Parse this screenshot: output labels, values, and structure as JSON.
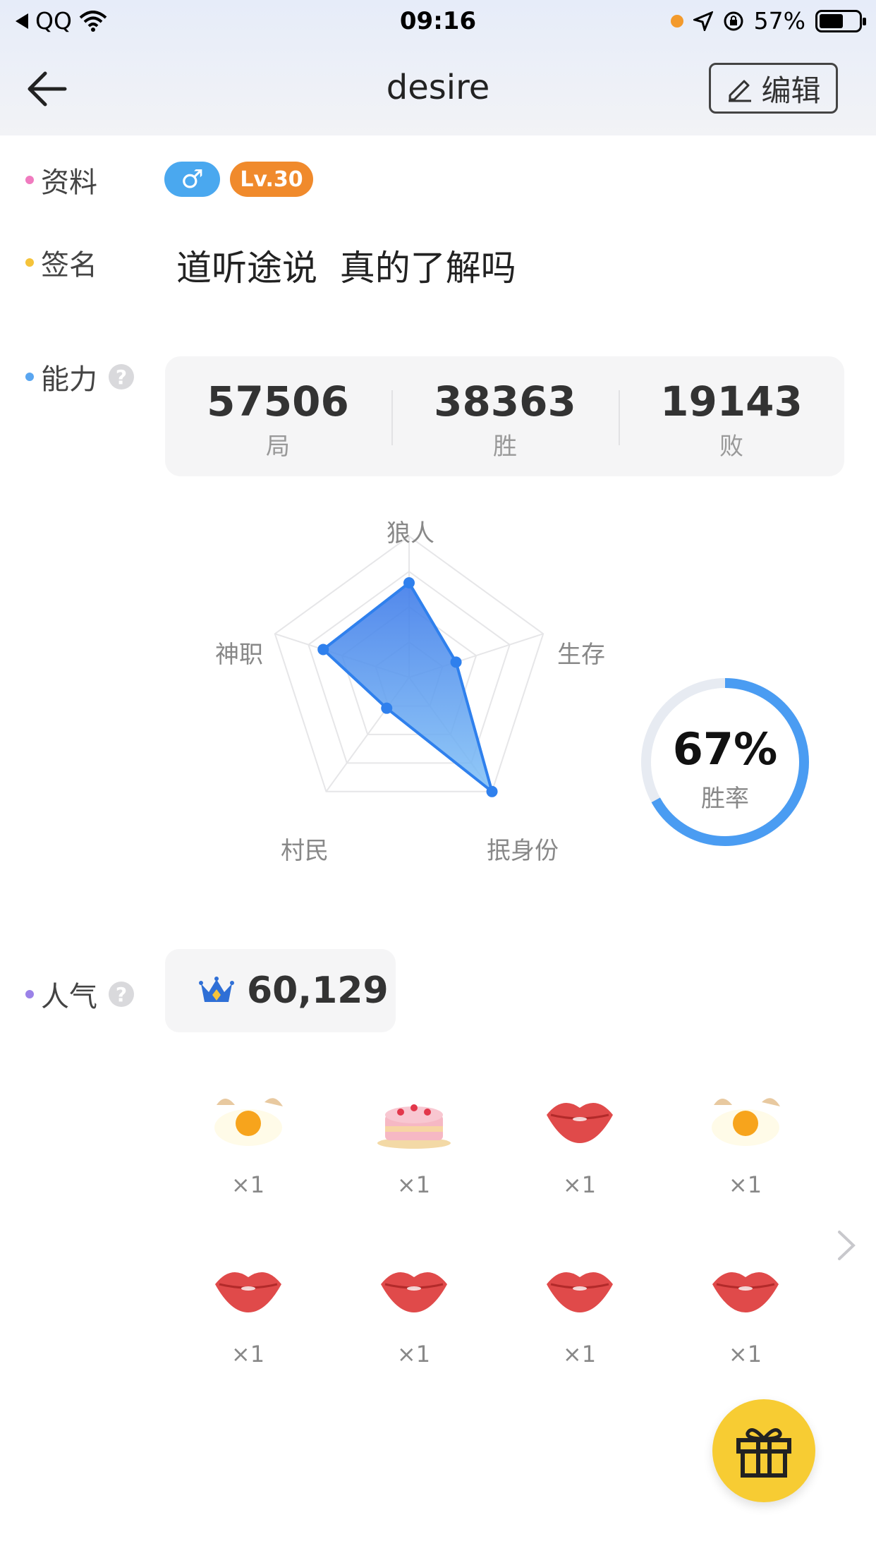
{
  "status_bar": {
    "carrier": "QQ",
    "time": "09:16",
    "battery": "57%",
    "icons": [
      "back-triangle-icon",
      "wifi-icon",
      "orange-dot-icon",
      "location-arrow-icon",
      "rotation-lock-icon",
      "battery-icon"
    ]
  },
  "nav": {
    "title": "desire",
    "edit_label": "编辑",
    "back_icon": "arrow-left-icon",
    "edit_icon": "pencil-icon"
  },
  "profile": {
    "label": "资料",
    "gender_symbol": "♂",
    "level": "Lv.30"
  },
  "signature": {
    "label": "签名",
    "text": "道听途说  真的了解吗"
  },
  "ability": {
    "label": "能力",
    "help": "?",
    "stats": [
      {
        "value": "57506",
        "label": "局"
      },
      {
        "value": "38363",
        "label": "胜"
      },
      {
        "value": "19143",
        "label": "败"
      }
    ],
    "radar": {
      "axes": [
        "狼人",
        "生存",
        "抿身份",
        "村民",
        "神职"
      ],
      "values": [
        0.67,
        0.35,
        1.0,
        0.27,
        0.64
      ]
    },
    "win_rate": {
      "value": "67%",
      "label": "胜率",
      "fraction": 0.67
    }
  },
  "popularity": {
    "label": "人气",
    "help": "?",
    "value": "60,129",
    "icon": "crown-icon"
  },
  "gifts": [
    {
      "icon": "egg-icon",
      "count": "×1"
    },
    {
      "icon": "cake-icon",
      "count": "×1"
    },
    {
      "icon": "lips-icon",
      "count": "×1"
    },
    {
      "icon": "egg-icon",
      "count": "×1"
    },
    {
      "icon": "lips-icon",
      "count": "×1"
    },
    {
      "icon": "lips-icon",
      "count": "×1"
    },
    {
      "icon": "lips-icon",
      "count": "×1"
    },
    {
      "icon": "lips-icon",
      "count": "×1"
    }
  ],
  "colors": {
    "header_bg": "#e9eefa",
    "bullet_pink": "#f07bbf",
    "bullet_yellow": "#f5c33a",
    "bullet_blue": "#5aa6f0",
    "bullet_purple": "#9b82e8",
    "gender_blue": "#4aa8ef",
    "level_orange": "#f08a2c",
    "radar_fill": "#4f8df0",
    "winrate_ring": "#4a9cf2",
    "fab_yellow": "#f7cc33"
  }
}
